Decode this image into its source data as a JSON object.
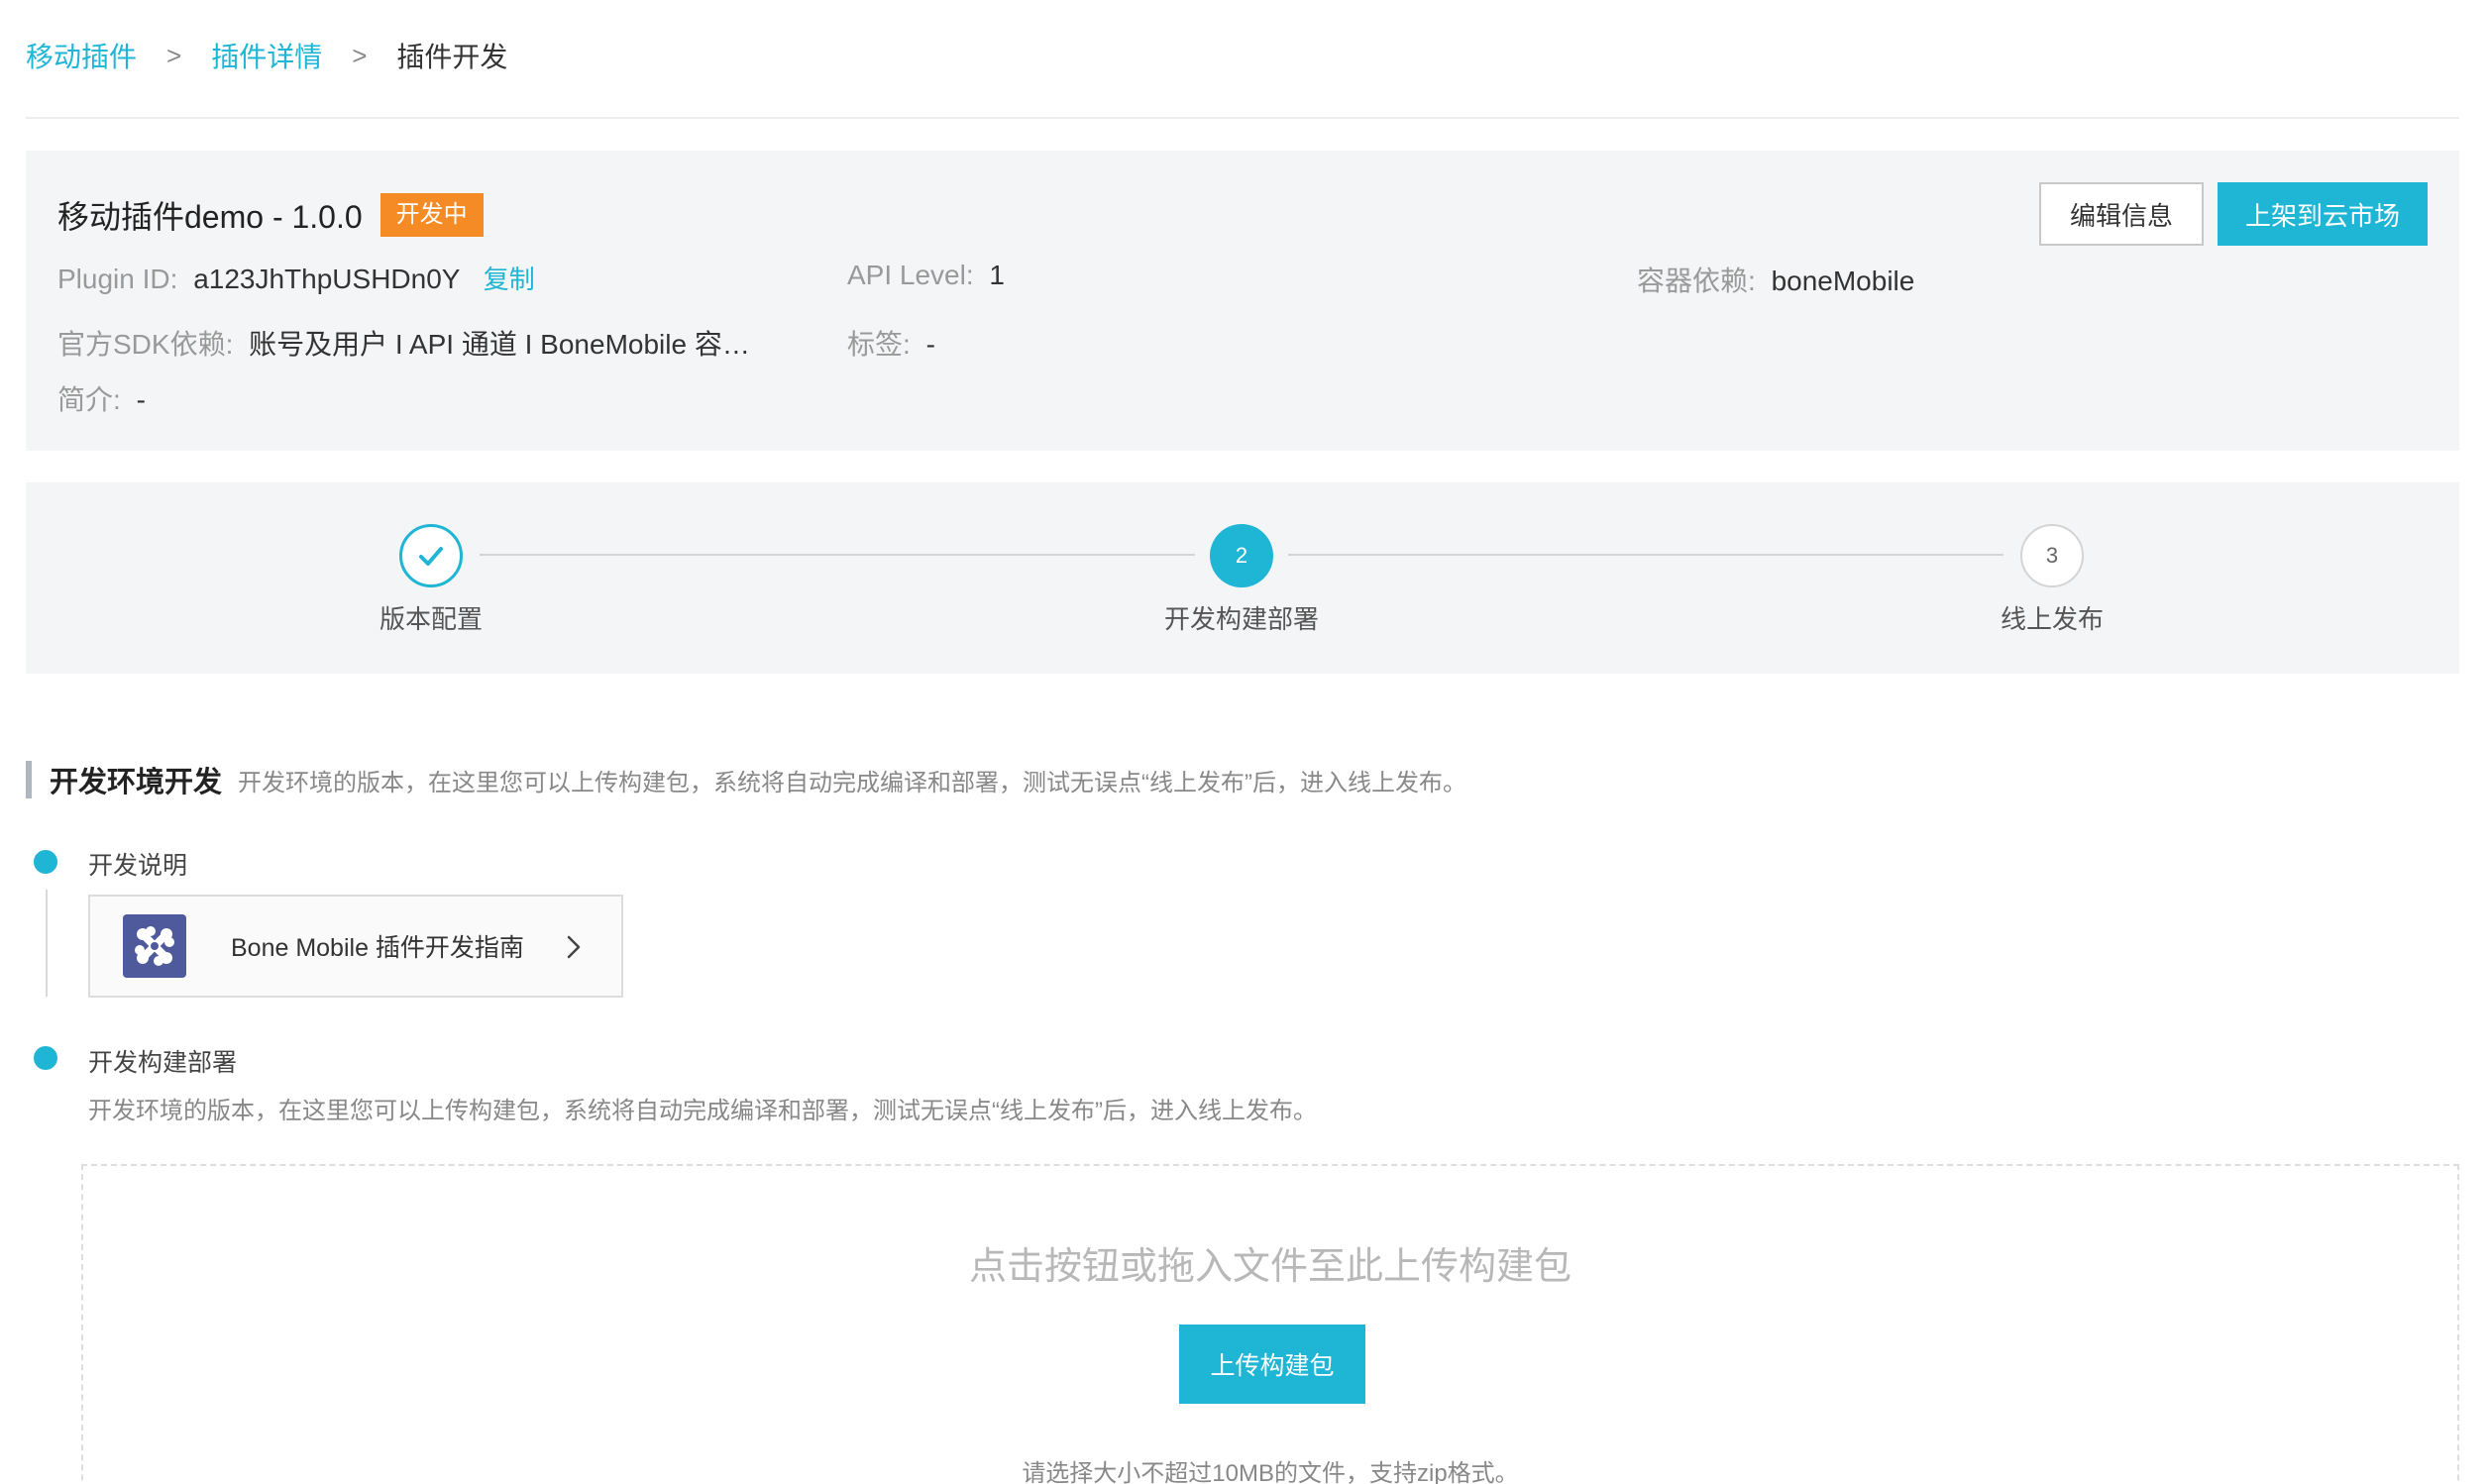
{
  "breadcrumb": {
    "items": [
      {
        "label": "移动插件"
      },
      {
        "label": "插件详情"
      },
      {
        "label": "插件开发"
      }
    ]
  },
  "plugin": {
    "name": "移动插件demo - 1.0.0",
    "status": "开发中",
    "edit_label": "编辑信息",
    "publish_label": "上架到云市场",
    "plugin_id_label": "Plugin ID:",
    "plugin_id": "a123JhThpUSHDn0Y",
    "copy_label": "复制",
    "api_level_label": "API Level:",
    "api_level": "1",
    "container_label": "容器依赖:",
    "container": "boneMobile",
    "sdk_label": "官方SDK依赖:",
    "sdk": "账号及用户 I API 通道 I BoneMobile 容…",
    "tags_label": "标签:",
    "tags": "-",
    "intro_label": "简介:",
    "intro": "-"
  },
  "steps": [
    {
      "label": "版本配置",
      "state": "done",
      "number": ""
    },
    {
      "label": "开发构建部署",
      "state": "active",
      "number": "2"
    },
    {
      "label": "线上发布",
      "state": "todo",
      "number": "3"
    }
  ],
  "section": {
    "title": "开发环境开发",
    "desc": "开发环境的版本，在这里您可以上传构建包，系统将自动完成编译和部署，测试无误点“线上发布”后，进入线上发布。"
  },
  "timeline": {
    "item1_title": "开发说明",
    "guide_label": "Bone Mobile 插件开发指南",
    "item2_title": "开发构建部署",
    "item2_desc": "开发环境的版本，在这里您可以上传构建包，系统将自动完成编译和部署，测试无误点“线上发布”后，进入线上发布。"
  },
  "upload": {
    "hint": "点击按钮或拖入文件至此上传构建包",
    "button_label": "上传构建包",
    "note": "请选择大小不超过10MB的文件，支持zip格式。"
  },
  "colors": {
    "accent": "#1fb5d4",
    "status_badge": "#f58b25",
    "guide_icon_bg": "#4e5a9c"
  }
}
